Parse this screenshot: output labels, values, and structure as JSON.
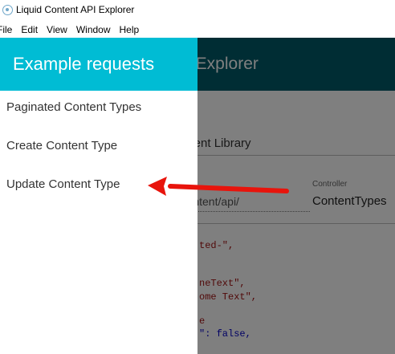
{
  "window": {
    "title": "Liquid Content API Explorer",
    "icon": "app-icon"
  },
  "menubar": {
    "items": [
      "File",
      "Edit",
      "View",
      "Window",
      "Help"
    ]
  },
  "app": {
    "header_title": "I Explorer",
    "library_text": "Content Library",
    "url_text": "m/content/api/",
    "controller_label": "Controller",
    "controller_value": "ContentTypes",
    "code": {
      "line1": "ted-\",",
      "line2": "neText\",",
      "line3": "ome Text\",",
      "line4": "e",
      "line5": "\": false,"
    }
  },
  "drawer": {
    "title": "Example requests",
    "header_color": "#00bcd4",
    "items": [
      {
        "label": "Paginated Content Types"
      },
      {
        "label": "Create Content Type"
      },
      {
        "label": "Update Content Type"
      }
    ]
  },
  "annotation": {
    "arrow_color": "#e8140c",
    "points_to": "Update Content Type"
  }
}
